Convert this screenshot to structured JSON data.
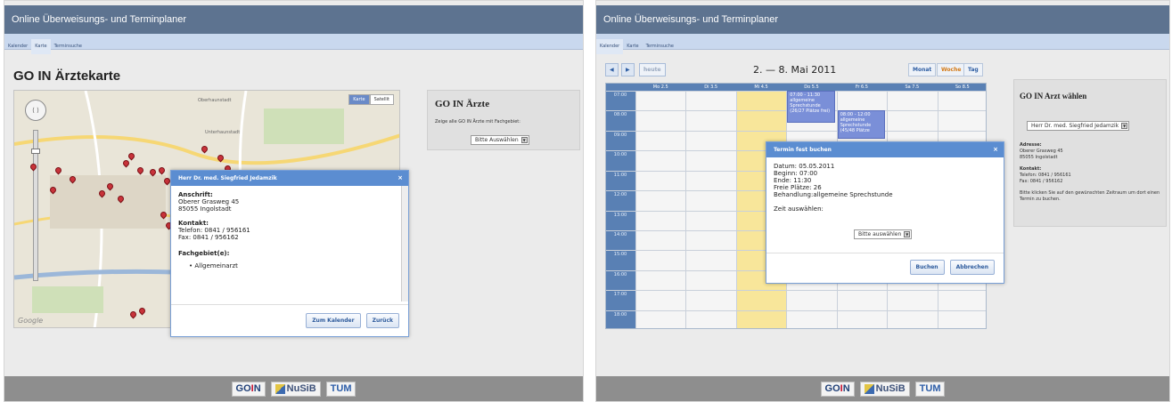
{
  "app_title": "Online Überweisungs- und Terminplaner",
  "nav_items": [
    "Kalender",
    "Karte",
    "Terminsuche"
  ],
  "footer_logos": {
    "goin_pre": "GO",
    "goin_mid": "I",
    "goin_post": "N",
    "nusib": "NuSiB",
    "tum": "TUM"
  },
  "colors": {
    "header": "#5d7390",
    "nav": "#c9d8ee",
    "dialog_head": "#5b8dd1",
    "today": "#f8e69a",
    "event": "#7a8fd8",
    "pin": "#c8333a"
  },
  "left": {
    "page_title": "GO IN Ärztekarte",
    "map": {
      "type_buttons": [
        "Karte",
        "Satellit"
      ],
      "selected_type": "Karte",
      "place_labels": [
        "Oberhaunstadt",
        "Unterhaunstadt"
      ],
      "pan_icon": "pan-arrows-icon",
      "copyright": "Google"
    },
    "sidebar": {
      "title": "GO IN Ärzte",
      "text": "Zeige alle GO IN Ärzte mit Fachgebiet:",
      "select_value": "Bitte Auswählen"
    },
    "dialog": {
      "title": "Herr Dr. med. Siegfried Jedamzik",
      "close": "×",
      "address_label": "Anschrift:",
      "address_lines": [
        "Oberer Grasweg 45",
        "85055 Ingolstadt"
      ],
      "contact_label": "Kontakt:",
      "contact_lines": [
        "Telefon: 0841 / 956161",
        "Fax: 0841 / 956162"
      ],
      "field_label": "Fachgebiet(e):",
      "fields": [
        "Allgemeinarzt"
      ],
      "btn_calendar": "Zum Kalender",
      "btn_back": "Zurück"
    }
  },
  "right": {
    "calendar": {
      "prev": "◀",
      "next": "▶",
      "today_btn": "heute",
      "title": "2. — 8. Mai 2011",
      "views": [
        "Monat",
        "Woche",
        "Tag"
      ],
      "active_view": "Woche",
      "days": [
        "Mo 2.5",
        "Di 3.5",
        "Mi 4.5",
        "Do 5.5",
        "Fr 6.5",
        "Sa 7.5",
        "So 8.5"
      ],
      "hours": [
        "07:00",
        "08:00",
        "09:00",
        "10:00",
        "11:00",
        "12:00",
        "13:00",
        "14:00",
        "15:00",
        "16:00",
        "17:00",
        "18:00"
      ],
      "events": [
        {
          "day_index": 3,
          "time": "07:00 - 11:30",
          "text": "allgemeine Sprechstunde",
          "extra": "(26/27 Plätze frei)"
        },
        {
          "day_index": 4,
          "time": "08:00 - 12:00",
          "text": "allgemeine Sprechstunde",
          "extra": "(45/48 Plätze"
        }
      ]
    },
    "sidebar": {
      "title": "GO IN Arzt wählen",
      "select_value": "Herr Dr. med. Siegfried Jedamzik",
      "address_label": "Adresse:",
      "address_lines": [
        "Oberer Grasweg 45",
        "85055 Ingolstadt"
      ],
      "contact_label": "Kontakt:",
      "contact_lines": [
        "Telefon: 0841 / 956161",
        "Fax: 0841 / 956162"
      ],
      "hint": "Bitte klicken Sie auf den gewünschten Zeitraum um dort einen Termin zu buchen."
    },
    "dialog": {
      "title": "Termin fest buchen",
      "close": "×",
      "lines": [
        "Datum: 05.05.2011",
        "Beginn: 07:00",
        "Ende: 11:30",
        "Freie Plätze: 26",
        "Behandlung:allgemeine Sprechstunde"
      ],
      "time_label": "Zeit auswählen:",
      "select_value": "Bitte auswählen",
      "btn_book": "Buchen",
      "btn_cancel": "Abbrechen"
    }
  }
}
